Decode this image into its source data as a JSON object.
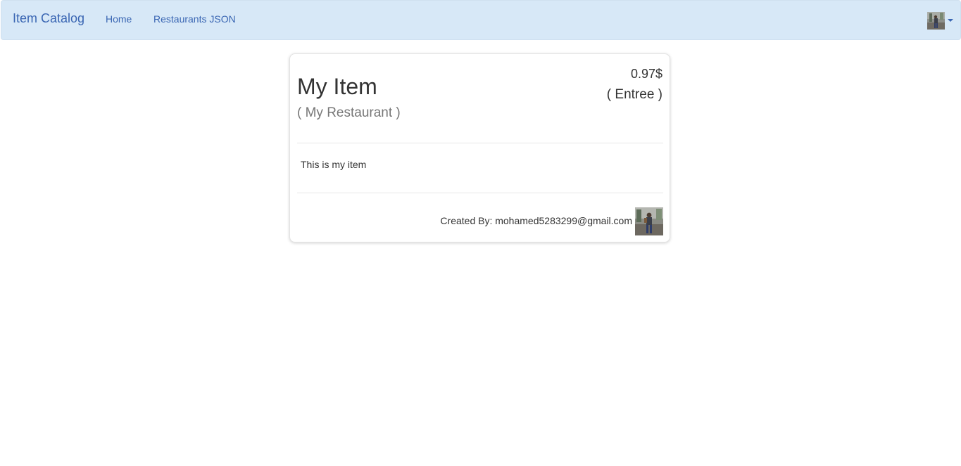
{
  "navbar": {
    "brand": "Item Catalog",
    "links": [
      {
        "label": "Home"
      },
      {
        "label": "Restaurants JSON"
      }
    ],
    "background_color": "#d7e8f7",
    "link_color": "#3a66b3",
    "user_menu_icon": "chevron-down-icon"
  },
  "item": {
    "name": "My Item",
    "restaurant": "( My Restaurant )",
    "price": "0.97$",
    "course": "( Entree )",
    "description": "This is my item",
    "created_by": "Created By: mohamed5283299@gmail.com"
  }
}
